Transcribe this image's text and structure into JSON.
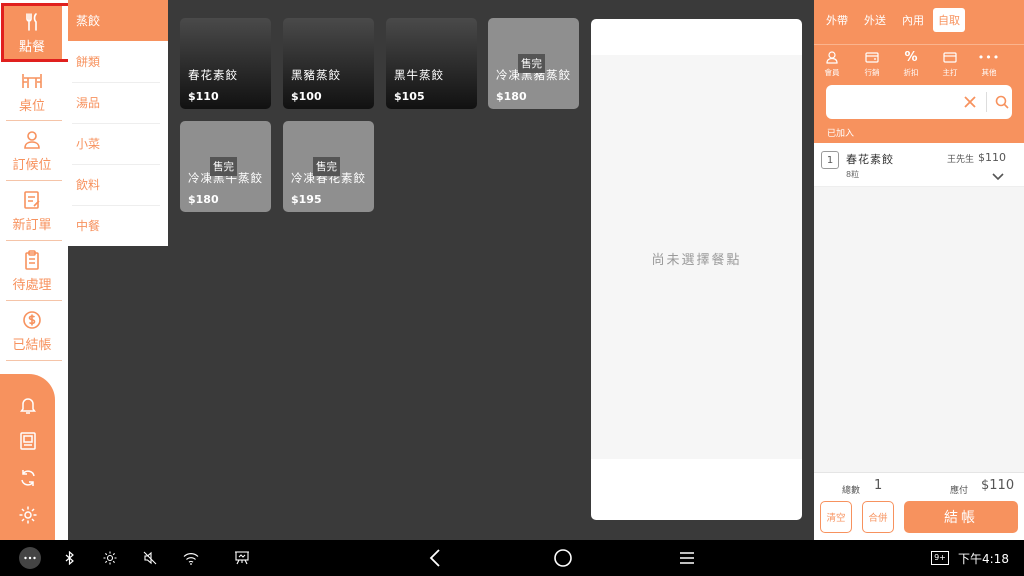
{
  "nav": {
    "items": [
      {
        "label": "點餐",
        "icon": "utensils-icon"
      },
      {
        "label": "桌位",
        "icon": "table-chairs-icon"
      },
      {
        "label": "訂候位",
        "icon": "person-icon"
      },
      {
        "label": "新訂單",
        "icon": "edit-document-icon"
      },
      {
        "label": "待處理",
        "icon": "clipboard-icon"
      },
      {
        "label": "已結帳",
        "icon": "dollar-circle-icon"
      }
    ],
    "bottom_icons": [
      "bell-icon",
      "receipt-icon",
      "sync-icon",
      "gear-icon"
    ]
  },
  "categories": [
    "蒸餃",
    "餅類",
    "湯品",
    "小菜",
    "飲料",
    "中餐"
  ],
  "products": [
    {
      "name": "春花素餃",
      "price": "$110",
      "sold_out": ""
    },
    {
      "name": "黑豬蒸餃",
      "price": "$100",
      "sold_out": ""
    },
    {
      "name": "黑牛蒸餃",
      "price": "$105",
      "sold_out": ""
    },
    {
      "name": "冷凍黑豬蒸餃",
      "price": "$180",
      "sold_out": "售完"
    },
    {
      "name": "冷凍黑牛蒸餃",
      "price": "$180",
      "sold_out": "售完"
    },
    {
      "name": "冷凍春花素餃",
      "price": "$195",
      "sold_out": "售完"
    }
  ],
  "detail": {
    "empty_text": "尚未選擇餐點"
  },
  "order": {
    "tabs": [
      "外帶",
      "外送",
      "內用",
      "自取"
    ],
    "active_tab": "自取",
    "tools": [
      {
        "label": "會員",
        "icon": "member-icon"
      },
      {
        "label": "行銷",
        "icon": "marketing-icon"
      },
      {
        "label": "折扣",
        "icon": "percent-icon"
      },
      {
        "label": "主打",
        "icon": "featured-icon"
      },
      {
        "label": "其他",
        "icon": "more-icon"
      }
    ],
    "search": {
      "value": "",
      "placeholder": ""
    },
    "added_label": "已加入",
    "lines": [
      {
        "qty": "1",
        "name": "春花素餃",
        "sub": "8粒",
        "customer": "王先生",
        "price": "$110"
      }
    ],
    "summary": {
      "count_label": "總數",
      "count_value": "1",
      "due_label": "應付",
      "due_value": "$110"
    },
    "buttons": {
      "clear": "清空",
      "merge": "合併",
      "checkout": "結帳"
    }
  },
  "system_bar": {
    "time": "下午4:18",
    "badge": "9+"
  },
  "colors": {
    "accent": "#f7925e",
    "highlight": "#e0201e",
    "background": "#3a3a3a"
  }
}
